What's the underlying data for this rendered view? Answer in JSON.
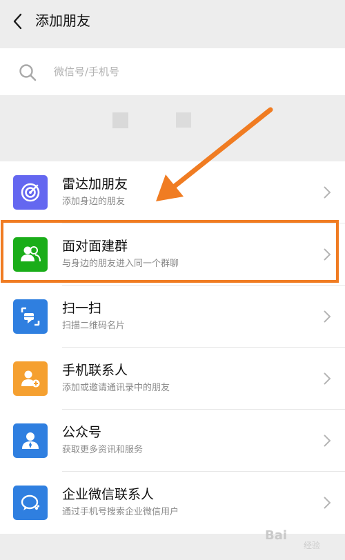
{
  "header": {
    "title": "添加朋友"
  },
  "search": {
    "placeholder": "微信号/手机号"
  },
  "items": [
    {
      "title": "雷达加朋友",
      "subtitle": "添加身边的朋友",
      "icon": "radar-icon",
      "color": "#6467f0"
    },
    {
      "title": "面对面建群",
      "subtitle": "与身边的朋友进入同一个群聊",
      "icon": "face-to-face-group-icon",
      "color": "#1aad19"
    },
    {
      "title": "扫一扫",
      "subtitle": "扫描二维码名片",
      "icon": "scan-icon",
      "color": "#2f7fe0"
    },
    {
      "title": "手机联系人",
      "subtitle": "添加或邀请通讯录中的朋友",
      "icon": "phone-contacts-icon",
      "color": "#f5a030"
    },
    {
      "title": "公众号",
      "subtitle": "获取更多资讯和服务",
      "icon": "official-account-icon",
      "color": "#2f7fe0"
    },
    {
      "title": "企业微信联系人",
      "subtitle": "通过手机号搜索企业微信用户",
      "icon": "work-wechat-icon",
      "color": "#2f7fe0"
    }
  ],
  "annotation": {
    "color": "#f07c22"
  },
  "watermark": {
    "brand": "Bai",
    "sub": "经验"
  }
}
